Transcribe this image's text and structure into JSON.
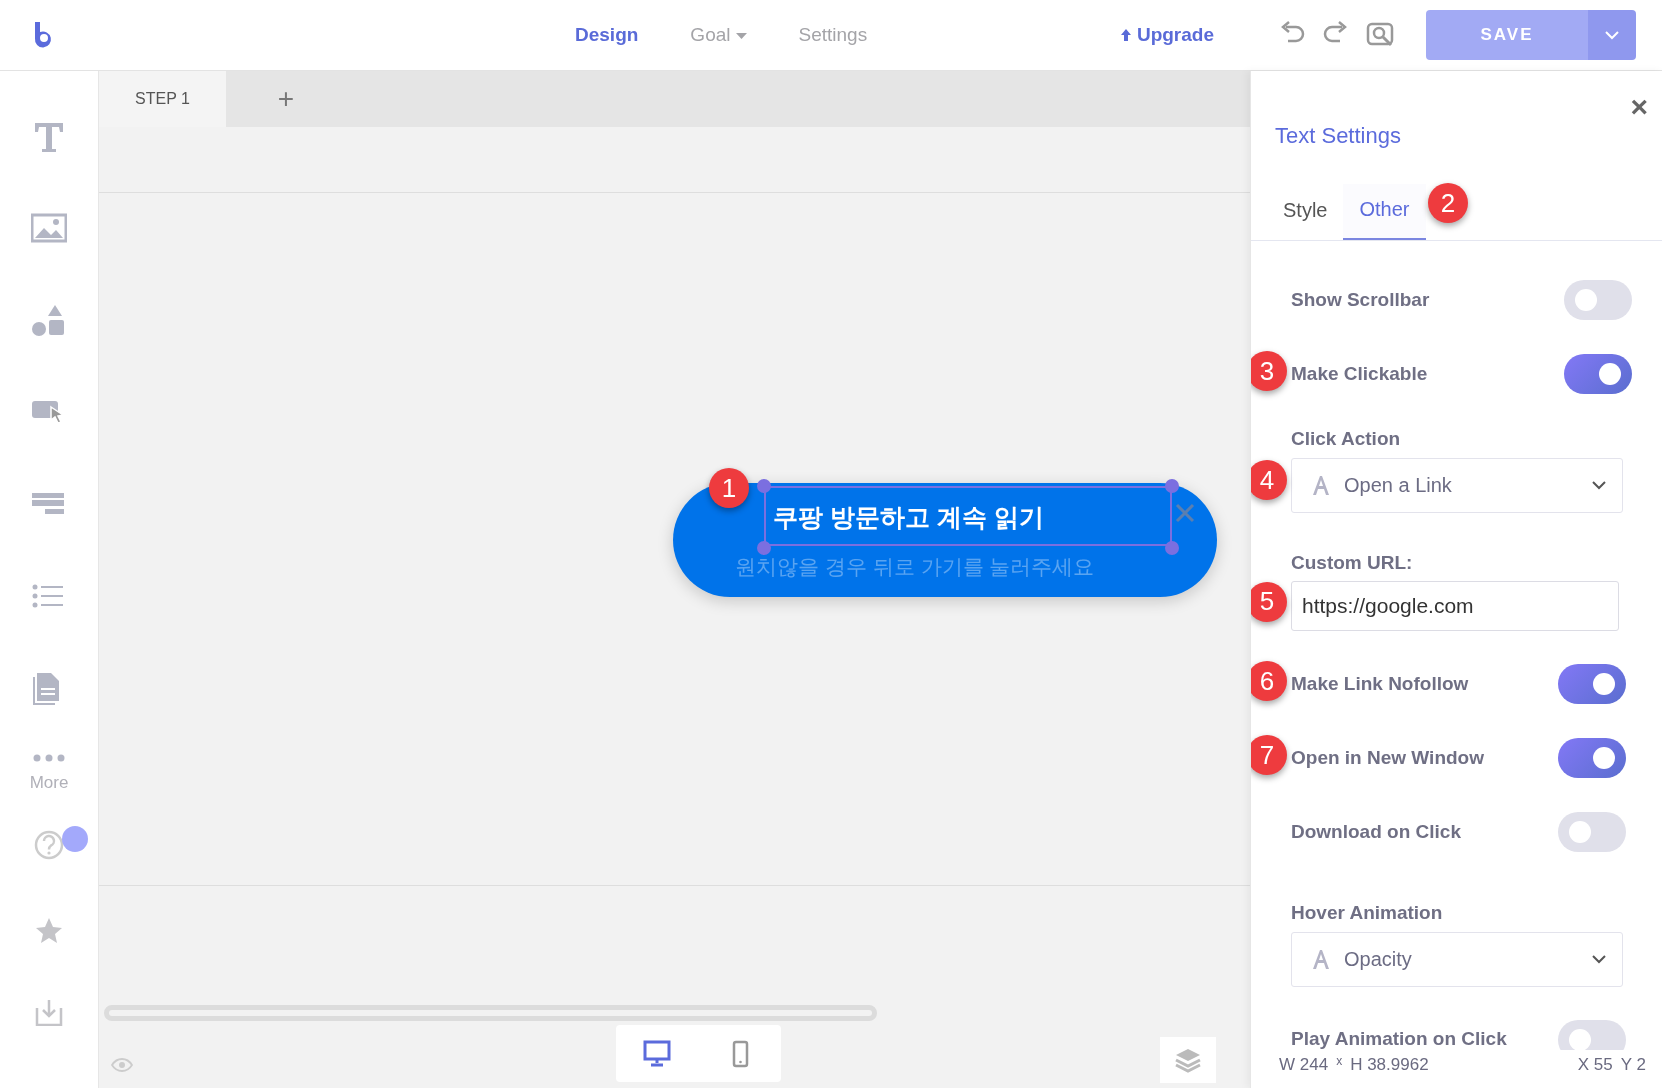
{
  "topbar": {
    "nav": [
      {
        "label": "Design",
        "selected": true,
        "has_menu": false
      },
      {
        "label": "Goal",
        "selected": false,
        "has_menu": true
      },
      {
        "label": "Settings",
        "selected": false,
        "has_menu": false
      }
    ],
    "upgrade": "Upgrade",
    "save": "SAVE"
  },
  "sidebar": {
    "more": "More"
  },
  "steps": [
    {
      "label": "STEP 1",
      "selected": true
    }
  ],
  "add_step": "+",
  "canvas": {
    "title": "쿠팡 방문하고 계속 읽기",
    "subtitle": "원치않을 경우 뒤로 가기를 눌러주세요",
    "selected": true,
    "marker": "1"
  },
  "devices": [
    {
      "kind": "desktop",
      "selected": true
    },
    {
      "kind": "mobile",
      "selected": false
    }
  ],
  "panel": {
    "title": "Text Settings",
    "close": "×",
    "tabs": [
      {
        "label": "Style",
        "selected": false
      },
      {
        "label": "Other",
        "selected": true,
        "marker": "2"
      }
    ],
    "settings": [
      {
        "kind": "toggle",
        "label": "Show Scrollbar",
        "on": false
      },
      {
        "kind": "toggle",
        "label": "Make Clickable",
        "on": true,
        "marker": "3"
      },
      {
        "kind": "select",
        "label": "Click Action",
        "value": "Open a Link",
        "marker": "4"
      },
      {
        "kind": "input",
        "label": "Custom URL:",
        "value": "https://google.com",
        "marker": "5"
      },
      {
        "kind": "toggle",
        "label": "Make Link Nofollow",
        "on": true,
        "marker": "6"
      },
      {
        "kind": "toggle",
        "label": "Open in New Window",
        "on": true,
        "marker": "7"
      },
      {
        "kind": "toggle",
        "label": "Download on Click",
        "on": false
      },
      {
        "kind": "select",
        "label": "Hover Animation",
        "value": "Opacity"
      },
      {
        "kind": "toggle",
        "label": "Play Animation on Click",
        "on": false
      }
    ],
    "status": {
      "width": "W 244",
      "times": "x",
      "height": "H 38.9962",
      "x": "X 55",
      "y": "Y 2"
    }
  }
}
